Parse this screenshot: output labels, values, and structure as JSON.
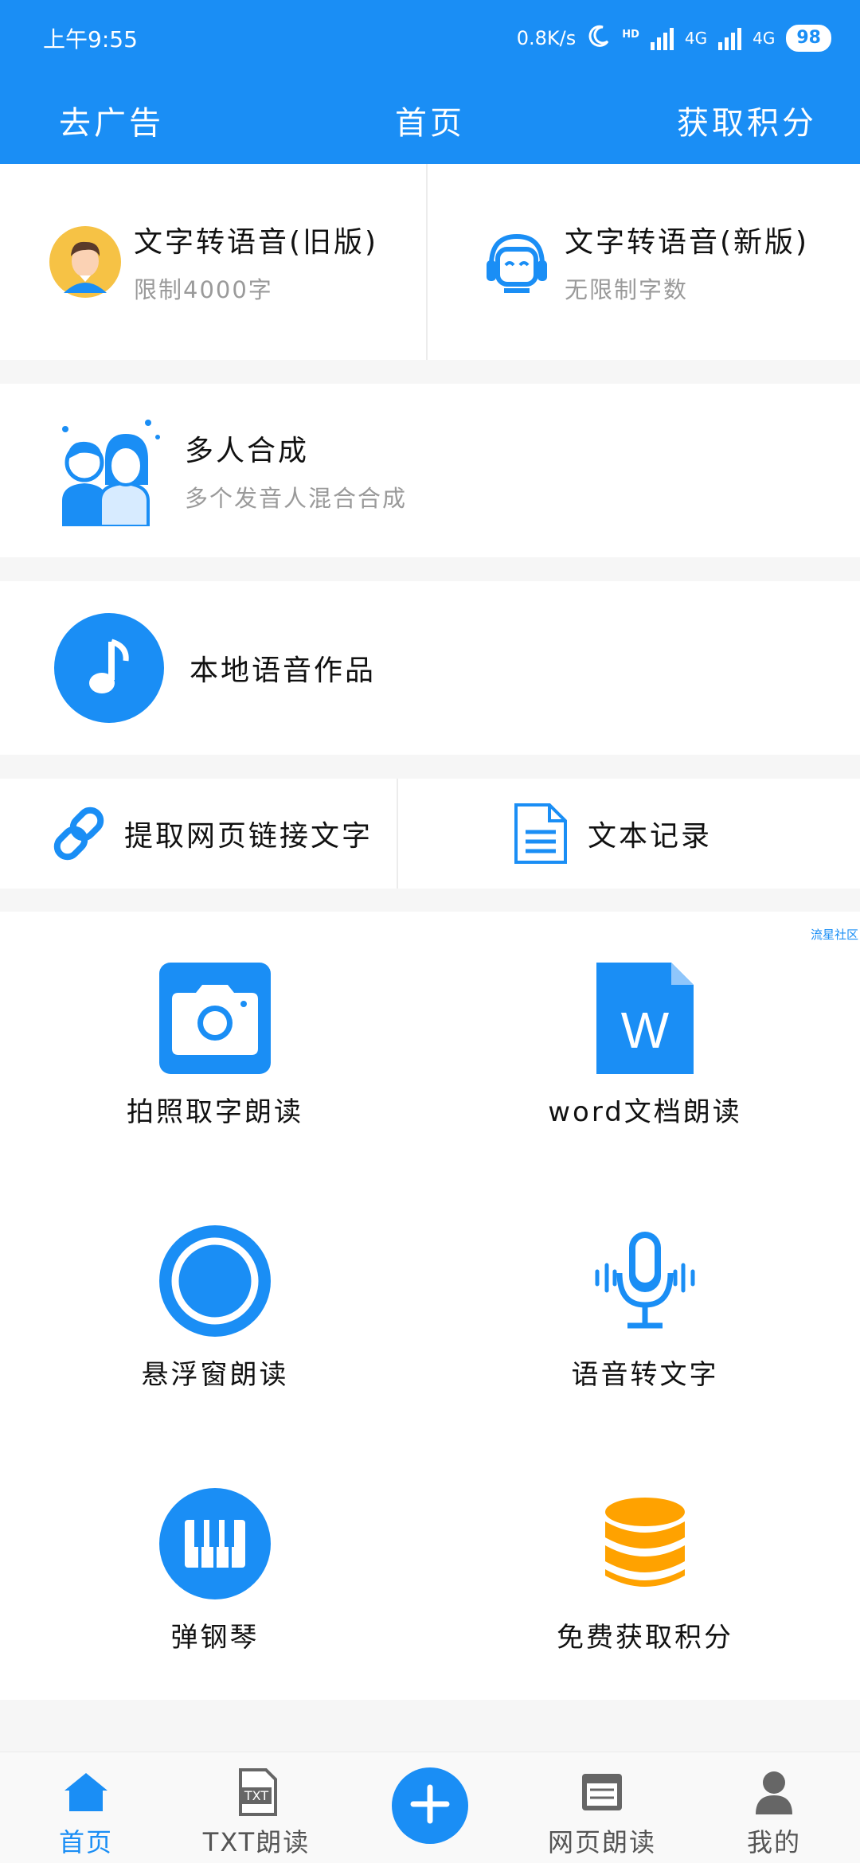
{
  "status_bar": {
    "time": "上午9:55",
    "net_speed": "0.8K/s",
    "hd_label": "HD",
    "net1": "4G",
    "net2": "4G",
    "battery": "98"
  },
  "app_bar": {
    "left": "去广告",
    "title": "首页",
    "right": "获取积分"
  },
  "top_features": [
    {
      "title": "文字转语音(旧版)",
      "subtitle": "限制4000字",
      "icon": "user-avatar-icon"
    },
    {
      "title": "文字转语音(新版)",
      "subtitle": "无限制字数",
      "icon": "headphones-robot-icon"
    }
  ],
  "multi_voice": {
    "title": "多人合成",
    "subtitle": "多个发音人混合合成",
    "icon": "people-icon"
  },
  "local_works": {
    "title": "本地语音作品",
    "icon": "music-note-icon"
  },
  "tools_row": [
    {
      "title": "提取网页链接文字",
      "icon": "link-icon"
    },
    {
      "title": "文本记录",
      "icon": "document-icon"
    }
  ],
  "ad_tag": "流星社区",
  "grid": [
    {
      "label": "拍照取字朗读",
      "icon": "camera-icon"
    },
    {
      "label": "word文档朗读",
      "icon": "word-file-icon",
      "icon_text": "W"
    },
    {
      "label": "悬浮窗朗读",
      "icon": "floating-circle-icon"
    },
    {
      "label": "语音转文字",
      "icon": "microphone-icon"
    },
    {
      "label": "弹钢琴",
      "icon": "piano-icon"
    },
    {
      "label": "免费获取积分",
      "icon": "coins-icon"
    }
  ],
  "tabs": [
    {
      "label": "首页",
      "icon": "home-icon",
      "active": true
    },
    {
      "label": "TXT朗读",
      "icon": "txt-file-icon",
      "icon_text": "TXT"
    },
    {
      "label": "网页朗读",
      "icon": "browser-icon"
    },
    {
      "label": "我的",
      "icon": "profile-icon"
    }
  ],
  "colors": {
    "primary": "#1a8ef5",
    "accent_orange": "#ffa200",
    "avatar_bg": "#f6c245"
  }
}
